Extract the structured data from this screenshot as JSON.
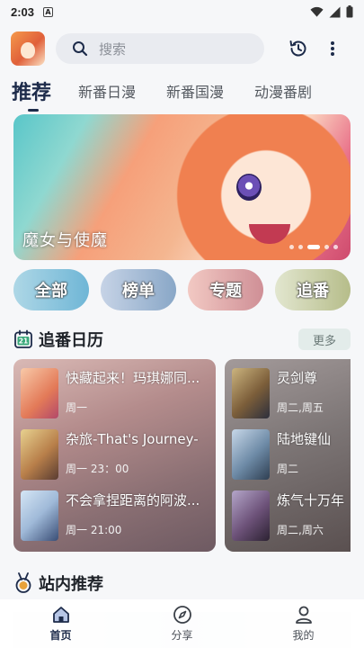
{
  "status": {
    "time": "2:03",
    "notif_letter": "A"
  },
  "search": {
    "placeholder": "搜索"
  },
  "tabs": [
    {
      "label": "推荐",
      "active": true
    },
    {
      "label": "新番日漫",
      "active": false
    },
    {
      "label": "新番国漫",
      "active": false
    },
    {
      "label": "动漫番剧",
      "active": false
    }
  ],
  "banner": {
    "title": "魔女与使魔",
    "slide_count": 5,
    "active_slide": 3
  },
  "quick_links": [
    {
      "label": "全部"
    },
    {
      "label": "榜单"
    },
    {
      "label": "专题"
    },
    {
      "label": "追番"
    }
  ],
  "calendar": {
    "title": "追番日历",
    "more_label": "更多",
    "icon_day": "21",
    "left_items": [
      {
        "name": "快藏起来！玛琪娜同...",
        "schedule": "周一"
      },
      {
        "name": "杂旅-That's Journey-",
        "schedule": "周一 23：00"
      },
      {
        "name": "不会拿捏距离的阿波...",
        "schedule": "周一 21:00"
      }
    ],
    "right_items": [
      {
        "name": "灵剑尊",
        "schedule": "周二,周五"
      },
      {
        "name": "陆地键仙",
        "schedule": "周二"
      },
      {
        "name": "炼气十万年",
        "schedule": "周二,周六"
      }
    ]
  },
  "recommend": {
    "title": "站内推荐"
  },
  "bottom_nav": [
    {
      "label": "首页",
      "icon": "home-icon",
      "active": true
    },
    {
      "label": "分享",
      "icon": "compass-icon",
      "active": false
    },
    {
      "label": "我的",
      "icon": "user-icon",
      "active": false
    }
  ],
  "colors": {
    "accent": "#1d2b4a",
    "more_pill_bg": "#e3ecea"
  }
}
